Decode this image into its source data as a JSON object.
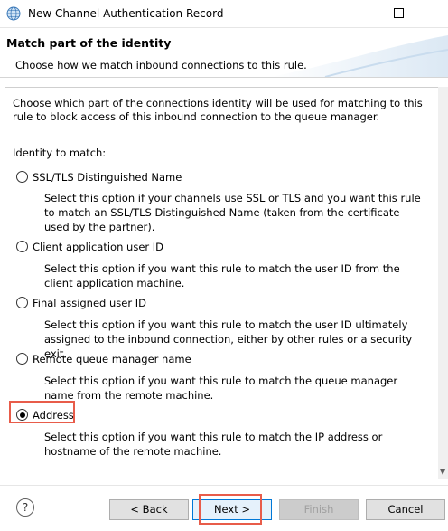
{
  "window": {
    "title": "New Channel Authentication Record",
    "icon": "globe-icon"
  },
  "header": {
    "title": "Match part of the identity",
    "description": "Choose how we match inbound connections to this rule."
  },
  "content": {
    "intro": "Choose which part of the connections identity will be used for matching to this rule to block access of this inbound connection to the queue manager.",
    "identity_label": "Identity to match:",
    "options": [
      {
        "label": "SSL/TLS Distinguished Name",
        "checked": false,
        "description": "Select this option if your channels use SSL or TLS and you want this rule to match an SSL/TLS Distinguished Name (taken from the certificate used by the partner)."
      },
      {
        "label": "Client application user ID",
        "checked": false,
        "description": "Select this option if you want this rule to match the user ID from the client application machine."
      },
      {
        "label": "Final assigned user ID",
        "checked": false,
        "description": "Select this option if you want this rule to match the user ID ultimately assigned to the inbound connection, either by other rules or a security exit."
      },
      {
        "label": "Remote queue manager name",
        "checked": false,
        "description": "Select this option if you want this rule to match the queue manager name from the remote machine."
      },
      {
        "label": "Address",
        "checked": true,
        "description": "Select this option if you want this rule to match the IP address or hostname of the remote machine."
      }
    ]
  },
  "footer": {
    "help": "?",
    "back": "< Back",
    "next": "Next >",
    "finish": "Finish",
    "cancel": "Cancel"
  },
  "colors": {
    "highlight": "#e85c4a",
    "focus": "#0078d7"
  }
}
